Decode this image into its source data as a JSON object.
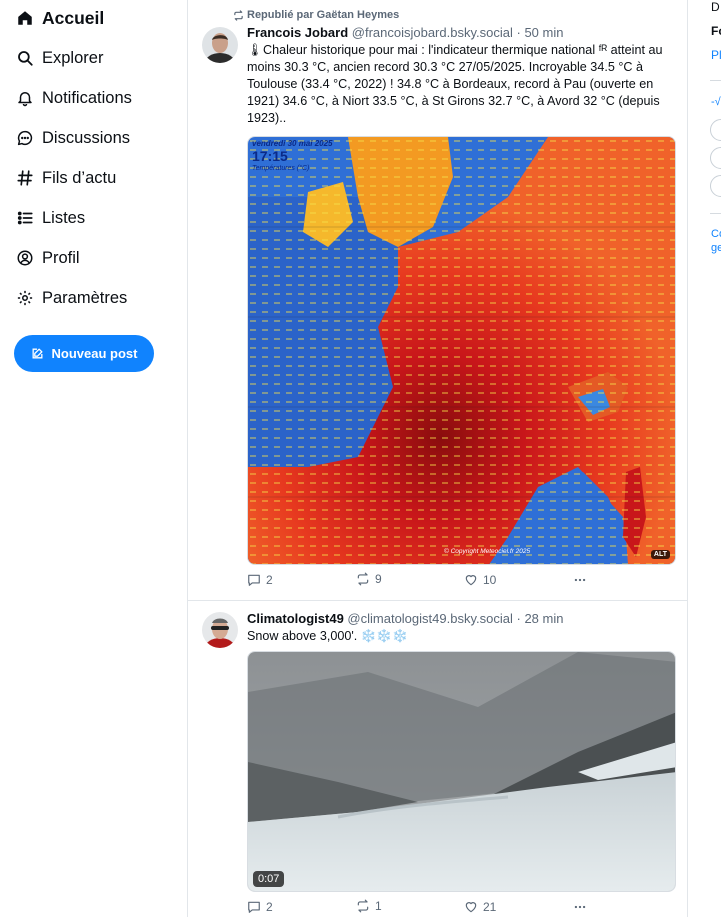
{
  "sidebar": {
    "items": [
      {
        "label": "Accueil",
        "icon": "home-icon"
      },
      {
        "label": "Explorer",
        "icon": "search-icon"
      },
      {
        "label": "Notifications",
        "icon": "bell-icon"
      },
      {
        "label": "Discussions",
        "icon": "chat-icon"
      },
      {
        "label": "Fils d’actu",
        "icon": "hashtag-icon"
      },
      {
        "label": "Listes",
        "icon": "list-icon"
      },
      {
        "label": "Profil",
        "icon": "user-icon"
      },
      {
        "label": "Paramètres",
        "icon": "gear-icon"
      }
    ],
    "new_post_label": "Nouveau post"
  },
  "feed": {
    "posts": [
      {
        "repost_label": "Republié par Gaëtan Heymes",
        "author_name": "Francois Jobard",
        "handle": "@francoisjobard.bsky.social",
        "time": "50 min",
        "text": "🌡Chaleur historique pour mai : l'indicateur thermique national ᶠᴿ atteint au moins 30.3 °C, ancien record 30.3 °C 27/05/2025. Incroyable 34.5 °C à Toulouse (33.4 °C, 2022) ! 34.8 °C à Bordeaux, record à Pau (ouverte en 1921) 34.6 °C, à Niort 33.5 °C, à St Girons 32.7 °C, à Avord 32 °C (depuis 1923)..",
        "media": {
          "overlay_title": "vendredi 30 mai 2025",
          "overlay_time": "17:15",
          "overlay_sub": "Températures (°C)",
          "copyright": "© Copyright Meteociel.fr 2025",
          "alt_badge": "ALT"
        },
        "replies": "2",
        "reposts": "9",
        "likes": "10"
      },
      {
        "author_name": "Climatologist49",
        "handle": "@climatologist49.bsky.social",
        "time": "28 min",
        "text": "Snow above 3,000'. ❄️❄️❄️",
        "media": {
          "duration": "0:07"
        },
        "replies": "2",
        "reposts": "1",
        "likes": "21"
      }
    ]
  },
  "right_column": {
    "line1": "D",
    "line2": "Fo",
    "line3": "Pl",
    "line4": "-√",
    "line5": "Co",
    "line6": "ge"
  },
  "colors": {
    "accent": "#1083fe",
    "muted_text": "#5b6877",
    "border": "#e2e6ea"
  }
}
